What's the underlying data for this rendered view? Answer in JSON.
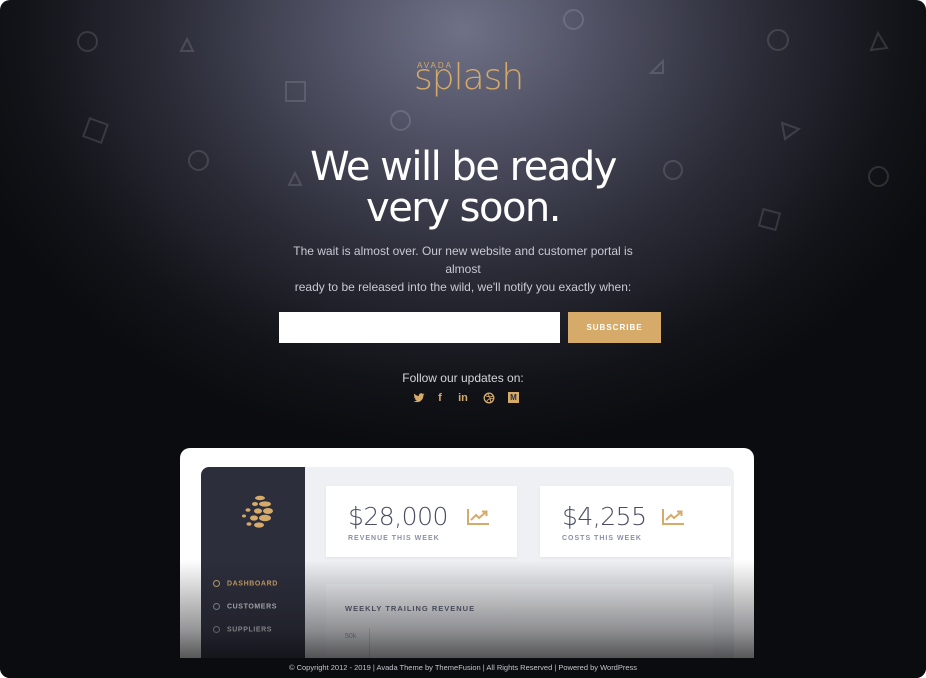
{
  "logo": {
    "small": "AVADA",
    "main": "splash"
  },
  "headline": {
    "line1": "We will be ready",
    "line2": "very soon."
  },
  "subtext": {
    "line1": "The wait is almost over. Our new website and customer portal is almost",
    "line2": "ready to be released into the wild, we'll notify you exactly when:"
  },
  "subscribe": {
    "input_value": "",
    "input_placeholder": "",
    "button_label": "SUBSCRIBE"
  },
  "follow": {
    "label": "Follow our updates on:",
    "icons": [
      "twitter-icon",
      "facebook-icon",
      "linkedin-icon",
      "dribbble-icon",
      "medium-icon"
    ],
    "glyphs": {
      "facebook": "f",
      "linkedin": "in",
      "medium": "M"
    }
  },
  "dashboard": {
    "nav": [
      "DASHBOARD",
      "CUSTOMERS",
      "SUPPLIERS"
    ],
    "cards": [
      {
        "value": "$28,000",
        "label": "REVENUE THIS WEEK",
        "icon": "trending-up-icon"
      },
      {
        "value": "$4,255",
        "label": "COSTS THIS WEEK",
        "icon": "trending-up-icon"
      }
    ],
    "panel_title": "WEEKLY TRAILING REVENUE",
    "panel_axis": "50k"
  },
  "footer": {
    "text": "© Copyright 2012 - 2019 | Avada Theme by ThemeFusion | All Rights Reserved | Powered by WordPress"
  },
  "colors": {
    "accent": "#d6ab6a",
    "background_dark": "#0b0c10",
    "sidebar": "#2c2e3c"
  }
}
